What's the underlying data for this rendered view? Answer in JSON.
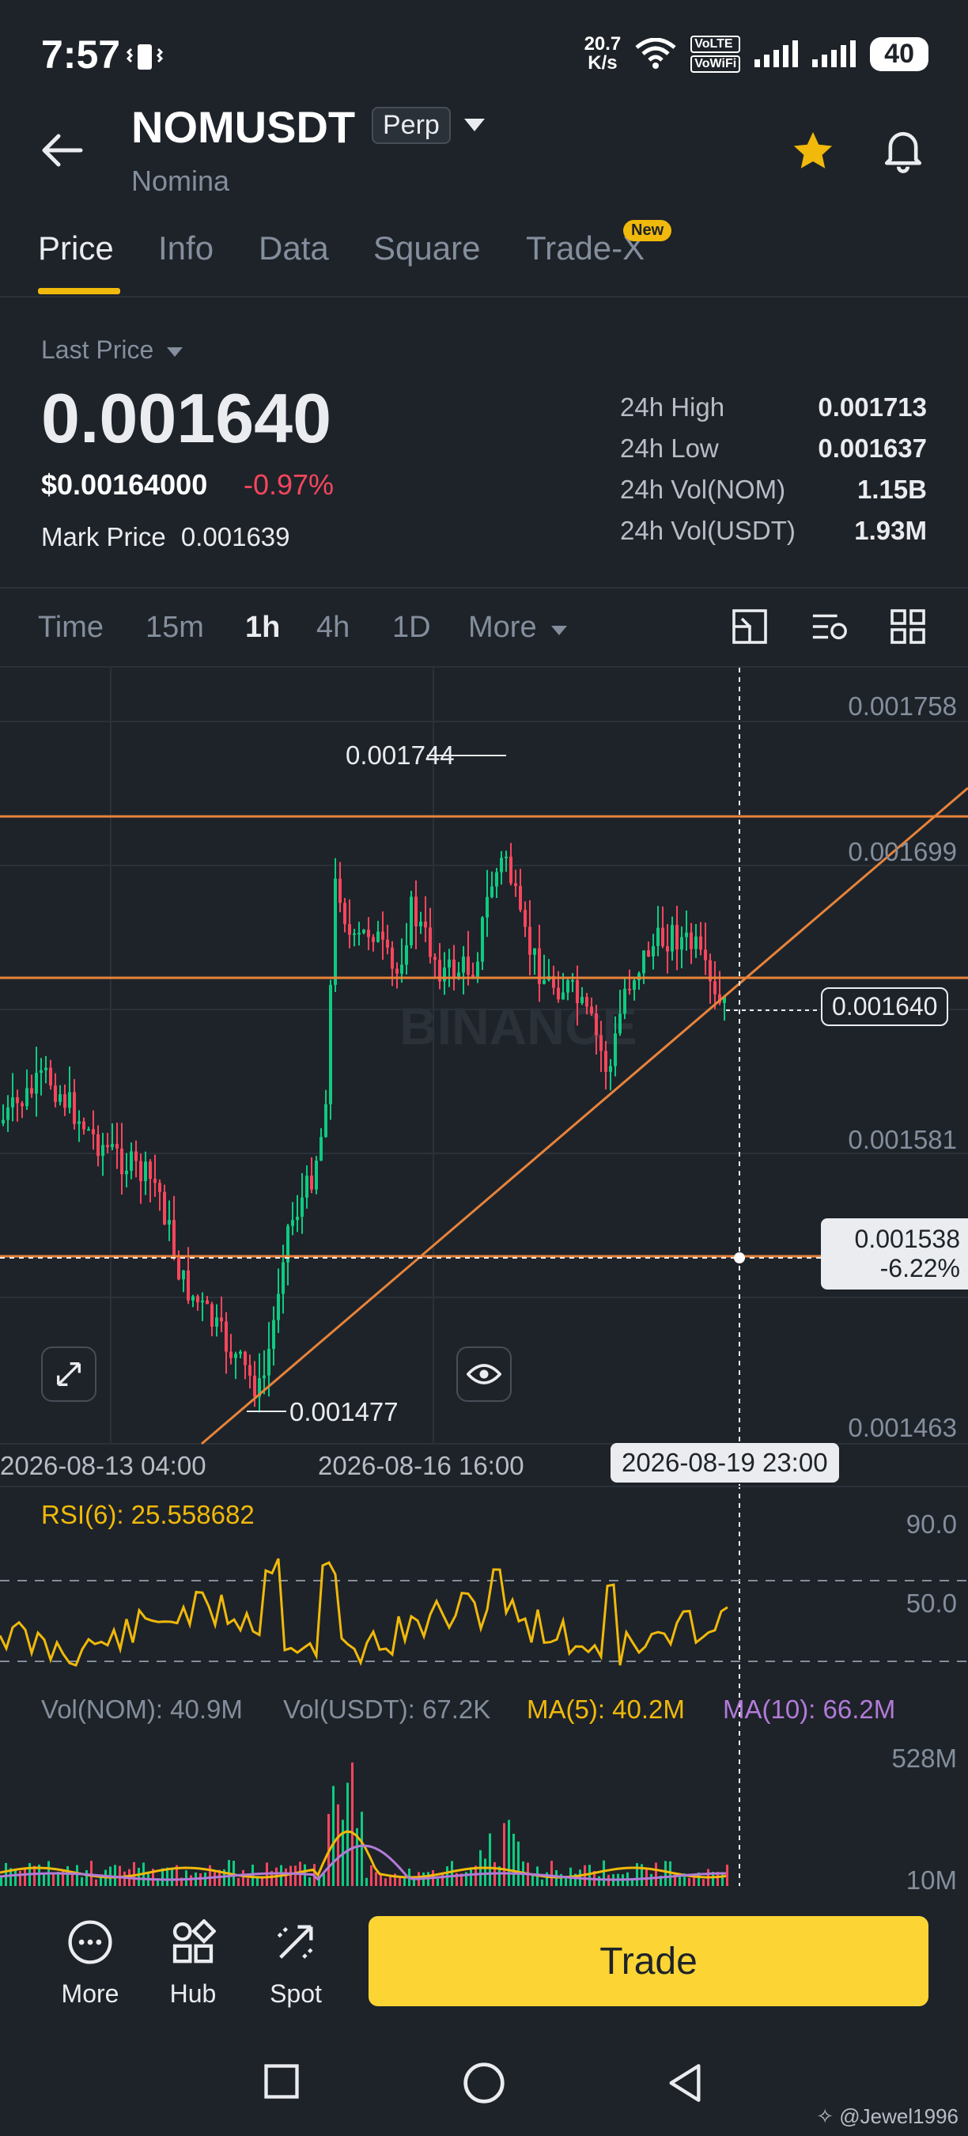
{
  "status": {
    "time": "7:57",
    "net_speed": "20.7\nK/s",
    "net_speed_value": "20.7",
    "net_speed_unit": "K/s",
    "volte1": "VoLTE",
    "volte2": "VoWiFi",
    "battery": "40"
  },
  "header": {
    "symbol": "NOMUSDT",
    "contract_type": "Perp",
    "name": "Nomina"
  },
  "tabs": [
    {
      "label": "Price",
      "active": true
    },
    {
      "label": "Info"
    },
    {
      "label": "Data"
    },
    {
      "label": "Square"
    },
    {
      "label": "Trade-X",
      "badge": "New"
    }
  ],
  "price": {
    "last_price_label": "Last Price",
    "last_price": "0.001640",
    "usd_price": "$0.00164000",
    "change_pct": "-0.97%",
    "mark_price_label": "Mark Price",
    "mark_price": "0.001639"
  },
  "stats": [
    {
      "label": "24h High",
      "value": "0.001713"
    },
    {
      "label": "24h Low",
      "value": "0.001637"
    },
    {
      "label": "24h Vol(NOM)",
      "value": "1.15B"
    },
    {
      "label": "24h Vol(USDT)",
      "value": "1.93M"
    }
  ],
  "intervals": {
    "items": [
      "Time",
      "15m",
      "1h",
      "4h",
      "1D",
      "More"
    ],
    "active": "1h"
  },
  "chart": {
    "price_axis": [
      "0.001758",
      "0.001699",
      "0.001640",
      "0.001581",
      "0.001463"
    ],
    "current_price_tag": "0.001640",
    "crosshair_price": "0.001538",
    "crosshair_pct": "-6.22%",
    "high_label": "0.001744",
    "low_label": "0.001477",
    "date_labels": [
      "2026-08-13 04:00",
      "2026-08-16 16:00"
    ],
    "crosshair_date": "2026-08-19 23:00",
    "watermark": "BINANCE"
  },
  "rsi": {
    "label": "RSI(6): 25.558682",
    "axis": [
      "90.0",
      "50.0"
    ]
  },
  "volume": {
    "nom": "Vol(NOM): 40.9M",
    "usdt": "Vol(USDT): 67.2K",
    "ma5": "MA(5): 40.2M",
    "ma10": "MA(10): 66.2M",
    "axis": [
      "528M",
      "10M"
    ]
  },
  "bottom_bar": {
    "more": "More",
    "hub": "Hub",
    "spot": "Spot",
    "trade": "Trade"
  },
  "watermark_user": "@Jewel1996",
  "colors": {
    "background": "#1e2329",
    "accent": "#f0b90b",
    "up": "#0ecb81",
    "down": "#f6465d",
    "trendline": "#e8833a",
    "ma10": "#b27bd8"
  }
}
